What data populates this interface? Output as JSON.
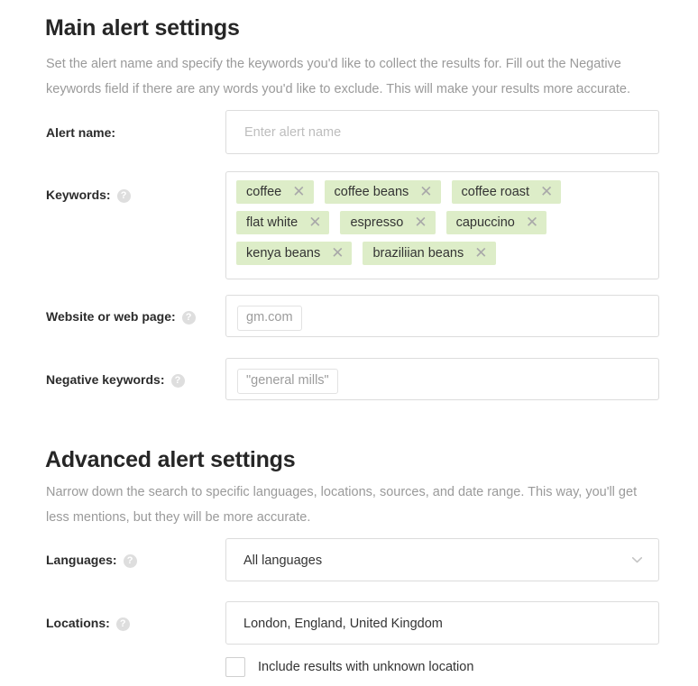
{
  "main_section": {
    "title": "Main alert settings",
    "description": "Set the alert name and specify the keywords you'd like to collect the results for. Fill out the Negative keywords field if there are any words you'd like to exclude. This will make your results more accurate."
  },
  "advanced_section": {
    "title": "Advanced alert settings",
    "description": "Narrow down the search to specific languages, locations, sources, and date range. This way, you'll get less mentions, but they will be more accurate."
  },
  "fields": {
    "alert_name": {
      "label": "Alert name:",
      "placeholder": "Enter alert name",
      "value": ""
    },
    "keywords": {
      "label": "Keywords:",
      "help_icon": "question-mark-icon",
      "tags": [
        "coffee",
        "coffee beans",
        "coffee roast",
        "flat white",
        "espresso",
        "capuccino",
        "kenya beans",
        "braziliian beans"
      ],
      "remove_icon": "close-icon"
    },
    "website": {
      "label": "Website or web page:",
      "help_icon": "question-mark-icon",
      "token": "gm.com"
    },
    "negative_keywords": {
      "label": "Negative keywords:",
      "help_icon": "question-mark-icon",
      "token": "\"general mills\""
    },
    "languages": {
      "label": "Languages:",
      "help_icon": "question-mark-icon",
      "selected": "All languages",
      "chevron_icon": "chevron-down-icon"
    },
    "locations": {
      "label": "Locations:",
      "help_icon": "question-mark-icon",
      "value": "London, England, United Kingdom"
    },
    "unknown_location": {
      "label": "Include results with unknown location",
      "checked": false
    }
  },
  "colors": {
    "tag_background": "#ddedc8",
    "heading": "#262626",
    "muted_text": "#9a9a9a",
    "border": "#dcdcdc"
  }
}
